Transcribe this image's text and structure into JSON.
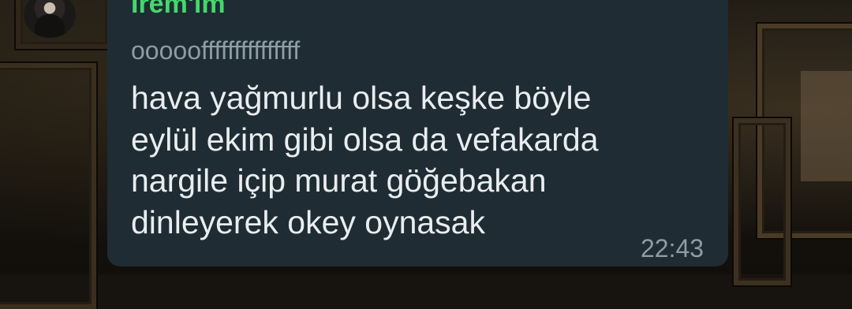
{
  "message": {
    "sender": "İrem'im",
    "quoted_text": "ooooofffffffffffffff",
    "body_lines": [
      "hava yağmurlu olsa keşke böyle",
      "eylül ekim gibi olsa da vefakarda",
      "nargile içip murat göğebakan",
      "dinleyerek okey oynasak"
    ],
    "time": "22:43"
  },
  "colors": {
    "bubble": "#1f2c34",
    "sender": "#45d86b",
    "text": "#e9edef",
    "meta": "#8e9ca4"
  },
  "icons": {
    "avatar": "profile-photo"
  }
}
